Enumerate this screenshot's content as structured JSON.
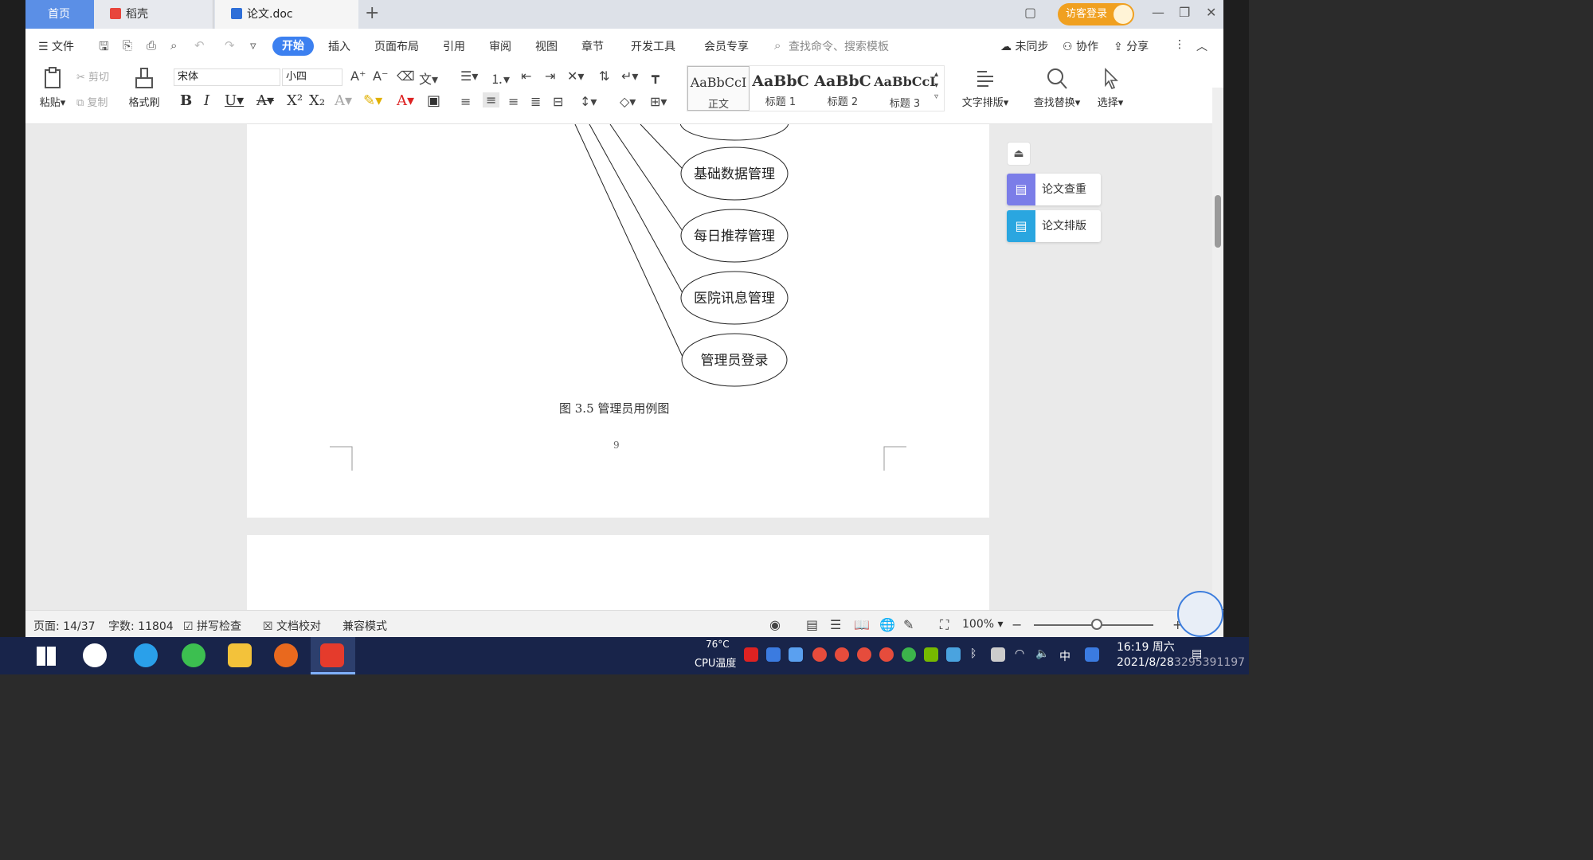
{
  "titlebar": {
    "tab_home": "首页",
    "tab_daoke": "稻壳",
    "tab_doc": "论文.doc",
    "add_tab": "+",
    "visitor_login": "访客登录"
  },
  "menu": {
    "file": "文件",
    "start": "开始",
    "insert": "插入",
    "page_layout": "页面布局",
    "reference": "引用",
    "review": "审阅",
    "view": "视图",
    "chapter": "章节",
    "dev_tools": "开发工具",
    "member": "会员专享",
    "search_placeholder": "查找命令、搜索模板",
    "unsynced": "未同步",
    "collaborate": "协作",
    "share": "分享"
  },
  "ribbon": {
    "paste": "粘贴",
    "cut": "剪切",
    "copy": "复制",
    "format_painter": "格式刷",
    "font_name": "宋体",
    "font_size": "小四",
    "style_sample": "AaBbCcI",
    "style_sample_bold": "AaBbC",
    "style_sample_h3": "AaBbCcI",
    "style_normal": "正文",
    "style_h1": "标题 1",
    "style_h2": "标题 2",
    "style_h3": "标题 3",
    "text_layout": "文字排版",
    "find_replace": "查找替换",
    "select": "选择"
  },
  "document": {
    "nodes": [
      "基础数据管理",
      "每日推荐管理",
      "医院讯息管理",
      "管理员登录"
    ],
    "caption": "图 3.5  管理员用例图",
    "page_number": "9"
  },
  "side_panel": {
    "plagiarism_check": "论文查重",
    "thesis_layout": "论文排版"
  },
  "statusbar": {
    "page": "页面: 14/37",
    "word_count": "字数: 11804",
    "spell_check": "拼写检查",
    "doc_proof": "文档校对",
    "compat_mode": "兼容模式",
    "zoom": "100%"
  },
  "taskbar": {
    "cpu_temp": "76°C",
    "cpu_label": "CPU温度",
    "ime": "中",
    "time": "16:19 周六",
    "date": "2021/8/28",
    "watermark": "3295391197"
  }
}
